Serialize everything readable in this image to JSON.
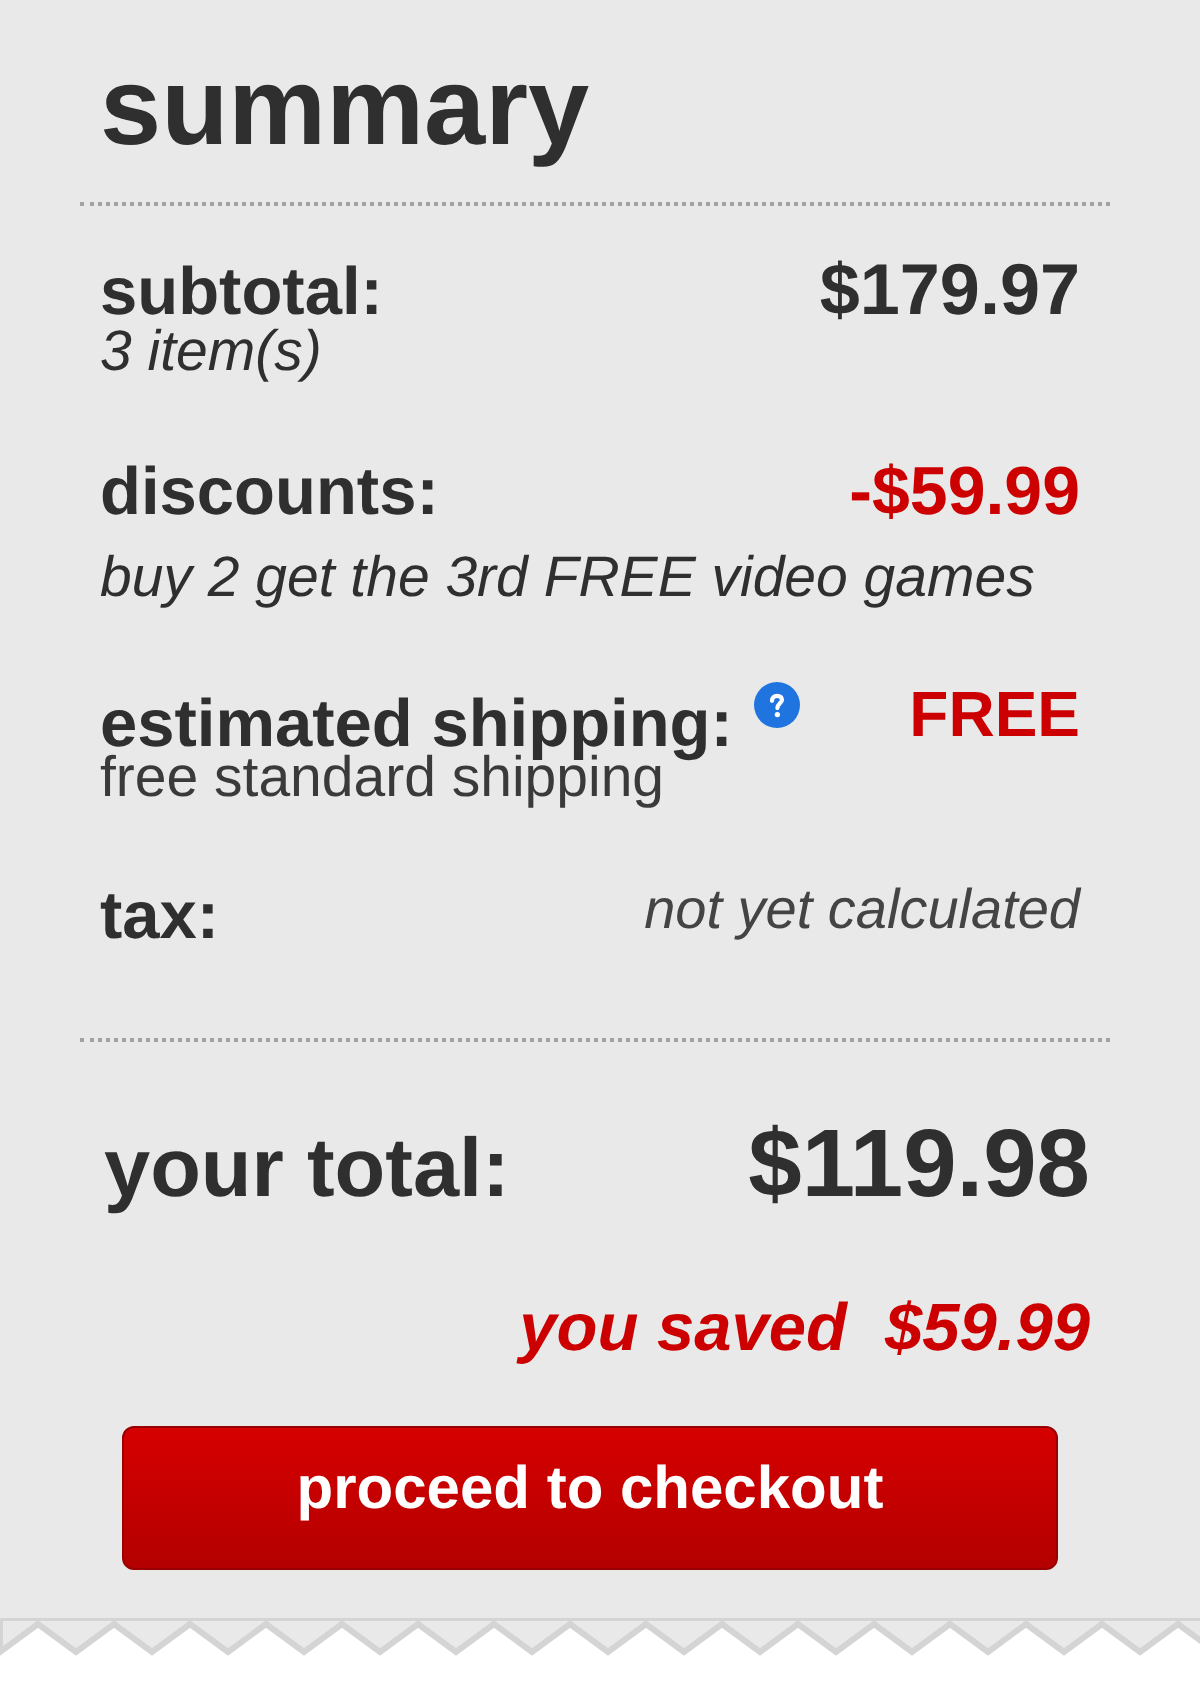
{
  "title": "summary",
  "rows": [
    {
      "kind": "subtotal",
      "label": "subtotal:",
      "value": "$179.97",
      "note": "3 item(s)",
      "help_icon": false
    },
    {
      "kind": "discount",
      "label": "discounts:",
      "value": "-$59.99",
      "note": "buy 2 get the 3rd FREE video games",
      "help_icon": false
    },
    {
      "kind": "shipping",
      "label": "estimated shipping:",
      "value": "FREE",
      "note": "free standard shipping",
      "help_icon": true
    },
    {
      "kind": "tax",
      "label": "tax:",
      "value": "not yet calculated",
      "help_icon": false
    }
  ],
  "total": {
    "label": "your total:",
    "value": "$119.98"
  },
  "savings": {
    "label": "you saved",
    "value": "$59.99"
  },
  "checkout_button": {
    "label": "proceed to checkout"
  }
}
